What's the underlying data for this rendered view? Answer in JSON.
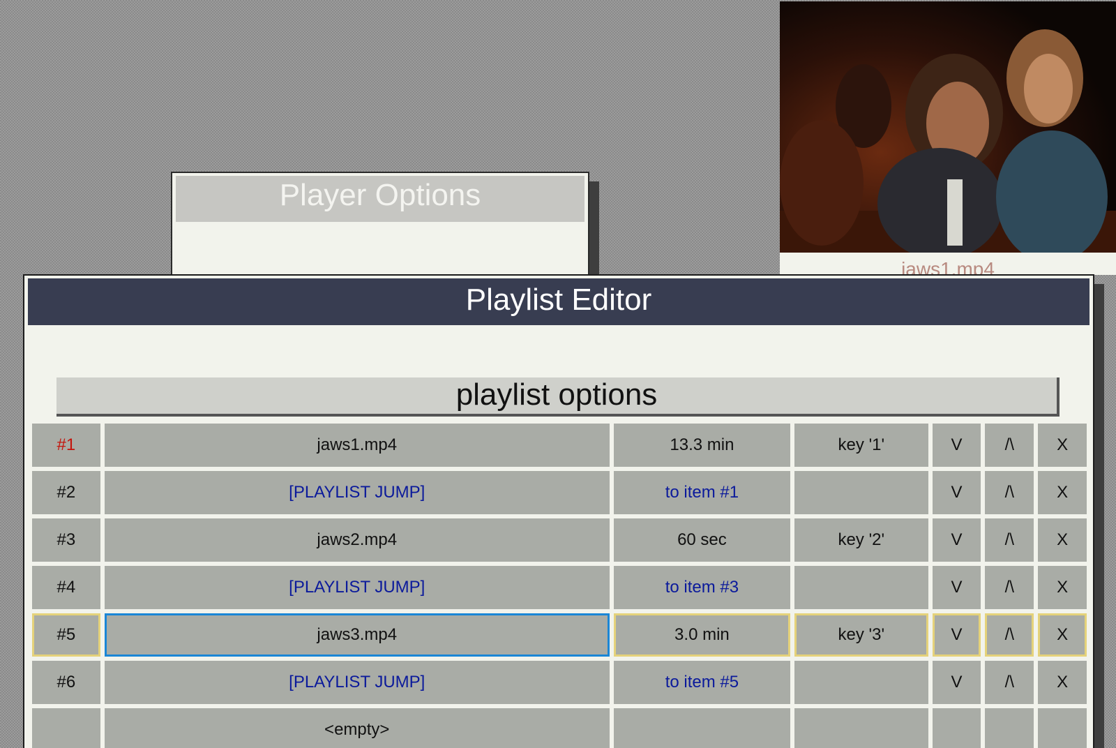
{
  "player_options": {
    "title": "Player Options"
  },
  "video": {
    "caption": "jaws1.mp4"
  },
  "playlist_editor": {
    "title": "Playlist Editor",
    "options_button": "playlist options",
    "rows": [
      {
        "num": "#1",
        "name": "jaws1.mp4",
        "duration": "13.3 min",
        "key": "key '1'",
        "down": "V",
        "up": "/\\",
        "remove": "X"
      },
      {
        "num": "#2",
        "name": "[PLAYLIST JUMP]",
        "duration": "to item #1",
        "key": "",
        "down": "V",
        "up": "/\\",
        "remove": "X"
      },
      {
        "num": "#3",
        "name": "jaws2.mp4",
        "duration": "60 sec",
        "key": "key '2'",
        "down": "V",
        "up": "/\\",
        "remove": "X"
      },
      {
        "num": "#4",
        "name": "[PLAYLIST JUMP]",
        "duration": "to item #3",
        "key": "",
        "down": "V",
        "up": "/\\",
        "remove": "X"
      },
      {
        "num": "#5",
        "name": "jaws3.mp4",
        "duration": "3.0 min",
        "key": "key '3'",
        "down": "V",
        "up": "/\\",
        "remove": "X"
      },
      {
        "num": "#6",
        "name": "[PLAYLIST JUMP]",
        "duration": "to item #5",
        "key": "",
        "down": "V",
        "up": "/\\",
        "remove": "X"
      },
      {
        "num": "",
        "name": "<empty>",
        "duration": "",
        "key": "",
        "down": "",
        "up": "",
        "remove": ""
      }
    ]
  },
  "colors": {
    "editor_title_bg": "#383d51",
    "cell_bg": "#a9aca6",
    "jump_text": "#0b1a9b",
    "active_number": "#c4140c",
    "selected_border": "#e5d27a",
    "focus_border": "#1a86d6"
  }
}
